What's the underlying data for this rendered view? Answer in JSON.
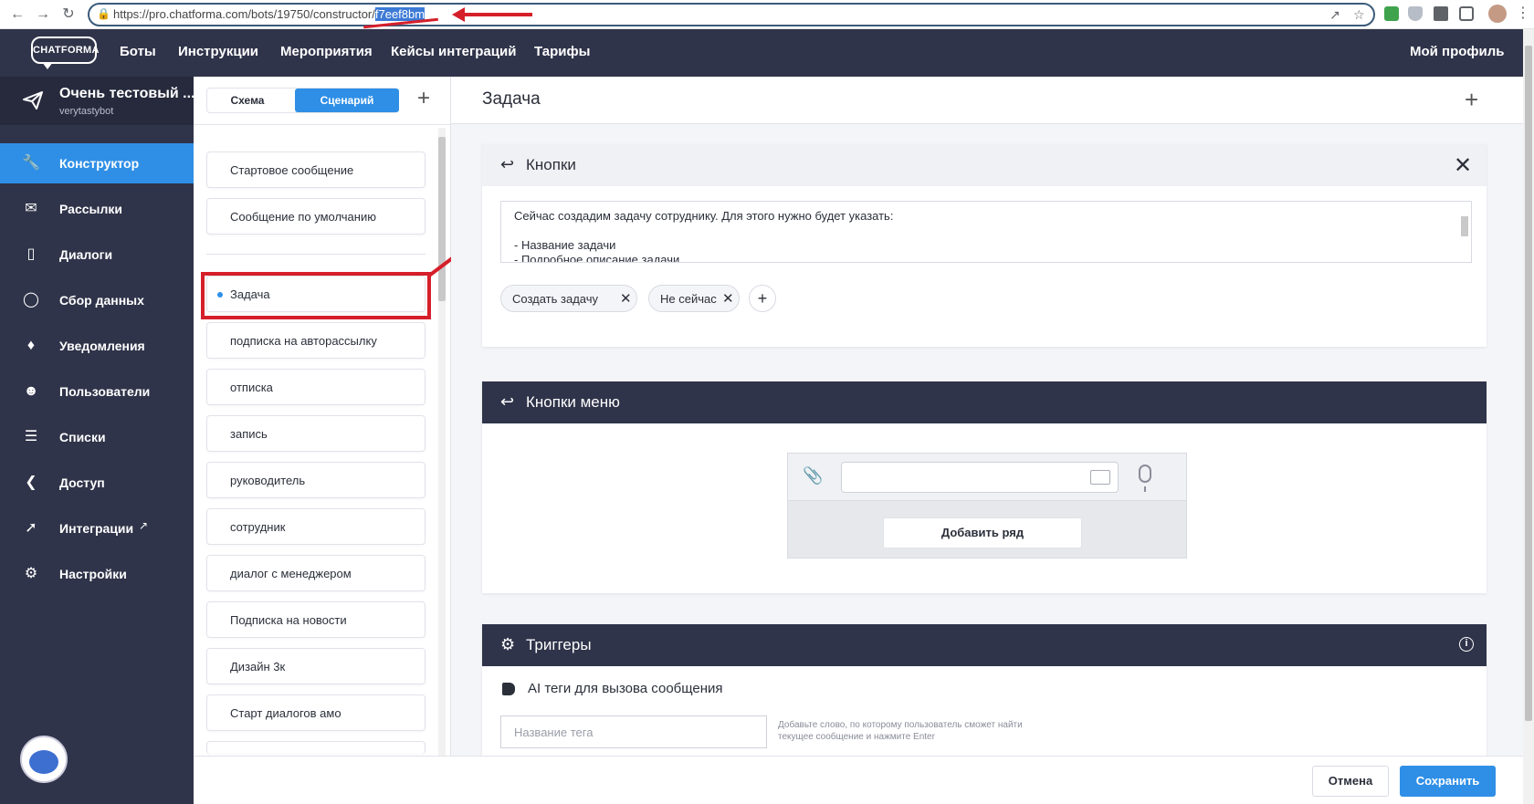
{
  "browser": {
    "url_prefix": "https://pro.chatforma.com/bots/19750/constructor/",
    "url_selected": "f7eef8bm"
  },
  "topnav": {
    "logo": "CHATFORMA",
    "items": [
      "Боты",
      "Инструкции",
      "Мероприятия",
      "Кейсы интеграций",
      "Тарифы"
    ],
    "profile": "Мой профиль"
  },
  "bot": {
    "name": "Очень тестовый ...",
    "username": "verytastybot"
  },
  "sidebar": {
    "items": [
      {
        "label": "Конструктор",
        "icon": "wrench-icon",
        "active": true
      },
      {
        "label": "Рассылки",
        "icon": "envelope-icon"
      },
      {
        "label": "Диалоги",
        "icon": "chat-icon"
      },
      {
        "label": "Сбор данных",
        "icon": "circle-chart-icon"
      },
      {
        "label": "Уведомления",
        "icon": "bell-icon"
      },
      {
        "label": "Пользователи",
        "icon": "users-icon"
      },
      {
        "label": "Списки",
        "icon": "list-icon"
      },
      {
        "label": "Доступ",
        "icon": "share-icon"
      },
      {
        "label": "Интеграции",
        "icon": "plug-icon"
      },
      {
        "label": "Настройки",
        "icon": "gear-icon"
      }
    ]
  },
  "scenarios": {
    "tabs": [
      "Схема",
      "Сценарий"
    ],
    "active_tab": "Сценарий",
    "pinned": [
      "Стартовое сообщение",
      "Сообщение по умолчанию"
    ],
    "items": [
      "Задача",
      "подписка на авторассылку",
      "отписка",
      "запись",
      "руководитель",
      "сотрудник",
      "диалог с менеджером",
      "Подписка на новости",
      "Дизайн 3к",
      "Старт диалогов амо"
    ],
    "selected": "Задача"
  },
  "main": {
    "title": "Задача",
    "buttons_card": {
      "title": "Кнопки",
      "message_lines": [
        "Сейчас создадим задачу сотруднику. Для этого нужно будет указать:",
        "",
        "- Название задачи",
        "- Подробное описание задачи"
      ],
      "chips": [
        "Создать задачу",
        "Не сейчас"
      ]
    },
    "menu_card": {
      "title": "Кнопки меню",
      "add_row": "Добавить ряд"
    },
    "triggers_card": {
      "title": "Триггеры",
      "tags_title": "AI теги для вызова сообщения",
      "tag_placeholder": "Название тега",
      "tag_hint": "Добавьте слово, по которому пользователь сможет найти текущее сообщение и нажмите Enter"
    }
  },
  "footer": {
    "cancel": "Отмена",
    "save": "Сохранить"
  },
  "colors": {
    "accent": "#2f8fe6",
    "dark": "#30344a",
    "annotation": "#d51f2a"
  }
}
